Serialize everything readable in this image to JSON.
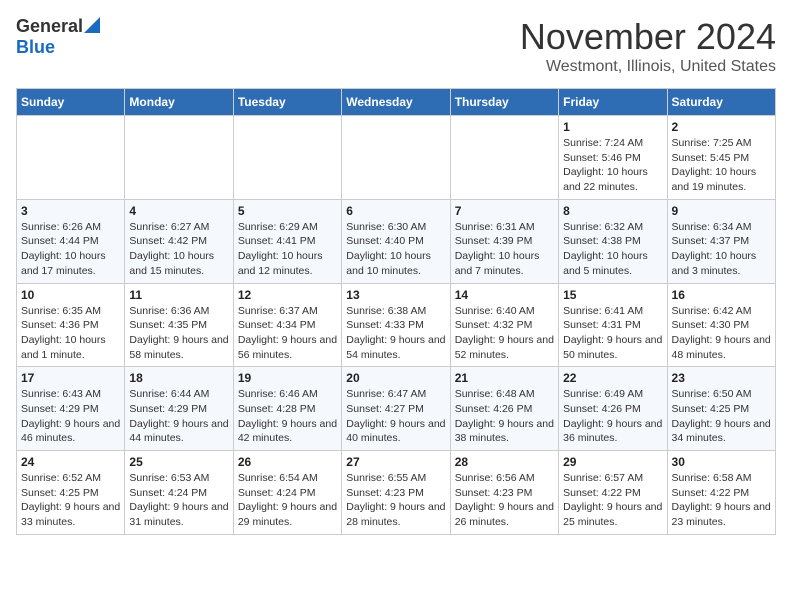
{
  "header": {
    "logo_general": "General",
    "logo_blue": "Blue",
    "month": "November 2024",
    "location": "Westmont, Illinois, United States"
  },
  "weekdays": [
    "Sunday",
    "Monday",
    "Tuesday",
    "Wednesday",
    "Thursday",
    "Friday",
    "Saturday"
  ],
  "weeks": [
    [
      {
        "day": "",
        "info": ""
      },
      {
        "day": "",
        "info": ""
      },
      {
        "day": "",
        "info": ""
      },
      {
        "day": "",
        "info": ""
      },
      {
        "day": "",
        "info": ""
      },
      {
        "day": "1",
        "info": "Sunrise: 7:24 AM\nSunset: 5:46 PM\nDaylight: 10 hours and 22 minutes."
      },
      {
        "day": "2",
        "info": "Sunrise: 7:25 AM\nSunset: 5:45 PM\nDaylight: 10 hours and 19 minutes."
      }
    ],
    [
      {
        "day": "3",
        "info": "Sunrise: 6:26 AM\nSunset: 4:44 PM\nDaylight: 10 hours and 17 minutes."
      },
      {
        "day": "4",
        "info": "Sunrise: 6:27 AM\nSunset: 4:42 PM\nDaylight: 10 hours and 15 minutes."
      },
      {
        "day": "5",
        "info": "Sunrise: 6:29 AM\nSunset: 4:41 PM\nDaylight: 10 hours and 12 minutes."
      },
      {
        "day": "6",
        "info": "Sunrise: 6:30 AM\nSunset: 4:40 PM\nDaylight: 10 hours and 10 minutes."
      },
      {
        "day": "7",
        "info": "Sunrise: 6:31 AM\nSunset: 4:39 PM\nDaylight: 10 hours and 7 minutes."
      },
      {
        "day": "8",
        "info": "Sunrise: 6:32 AM\nSunset: 4:38 PM\nDaylight: 10 hours and 5 minutes."
      },
      {
        "day": "9",
        "info": "Sunrise: 6:34 AM\nSunset: 4:37 PM\nDaylight: 10 hours and 3 minutes."
      }
    ],
    [
      {
        "day": "10",
        "info": "Sunrise: 6:35 AM\nSunset: 4:36 PM\nDaylight: 10 hours and 1 minute."
      },
      {
        "day": "11",
        "info": "Sunrise: 6:36 AM\nSunset: 4:35 PM\nDaylight: 9 hours and 58 minutes."
      },
      {
        "day": "12",
        "info": "Sunrise: 6:37 AM\nSunset: 4:34 PM\nDaylight: 9 hours and 56 minutes."
      },
      {
        "day": "13",
        "info": "Sunrise: 6:38 AM\nSunset: 4:33 PM\nDaylight: 9 hours and 54 minutes."
      },
      {
        "day": "14",
        "info": "Sunrise: 6:40 AM\nSunset: 4:32 PM\nDaylight: 9 hours and 52 minutes."
      },
      {
        "day": "15",
        "info": "Sunrise: 6:41 AM\nSunset: 4:31 PM\nDaylight: 9 hours and 50 minutes."
      },
      {
        "day": "16",
        "info": "Sunrise: 6:42 AM\nSunset: 4:30 PM\nDaylight: 9 hours and 48 minutes."
      }
    ],
    [
      {
        "day": "17",
        "info": "Sunrise: 6:43 AM\nSunset: 4:29 PM\nDaylight: 9 hours and 46 minutes."
      },
      {
        "day": "18",
        "info": "Sunrise: 6:44 AM\nSunset: 4:29 PM\nDaylight: 9 hours and 44 minutes."
      },
      {
        "day": "19",
        "info": "Sunrise: 6:46 AM\nSunset: 4:28 PM\nDaylight: 9 hours and 42 minutes."
      },
      {
        "day": "20",
        "info": "Sunrise: 6:47 AM\nSunset: 4:27 PM\nDaylight: 9 hours and 40 minutes."
      },
      {
        "day": "21",
        "info": "Sunrise: 6:48 AM\nSunset: 4:26 PM\nDaylight: 9 hours and 38 minutes."
      },
      {
        "day": "22",
        "info": "Sunrise: 6:49 AM\nSunset: 4:26 PM\nDaylight: 9 hours and 36 minutes."
      },
      {
        "day": "23",
        "info": "Sunrise: 6:50 AM\nSunset: 4:25 PM\nDaylight: 9 hours and 34 minutes."
      }
    ],
    [
      {
        "day": "24",
        "info": "Sunrise: 6:52 AM\nSunset: 4:25 PM\nDaylight: 9 hours and 33 minutes."
      },
      {
        "day": "25",
        "info": "Sunrise: 6:53 AM\nSunset: 4:24 PM\nDaylight: 9 hours and 31 minutes."
      },
      {
        "day": "26",
        "info": "Sunrise: 6:54 AM\nSunset: 4:24 PM\nDaylight: 9 hours and 29 minutes."
      },
      {
        "day": "27",
        "info": "Sunrise: 6:55 AM\nSunset: 4:23 PM\nDaylight: 9 hours and 28 minutes."
      },
      {
        "day": "28",
        "info": "Sunrise: 6:56 AM\nSunset: 4:23 PM\nDaylight: 9 hours and 26 minutes."
      },
      {
        "day": "29",
        "info": "Sunrise: 6:57 AM\nSunset: 4:22 PM\nDaylight: 9 hours and 25 minutes."
      },
      {
        "day": "30",
        "info": "Sunrise: 6:58 AM\nSunset: 4:22 PM\nDaylight: 9 hours and 23 minutes."
      }
    ]
  ]
}
